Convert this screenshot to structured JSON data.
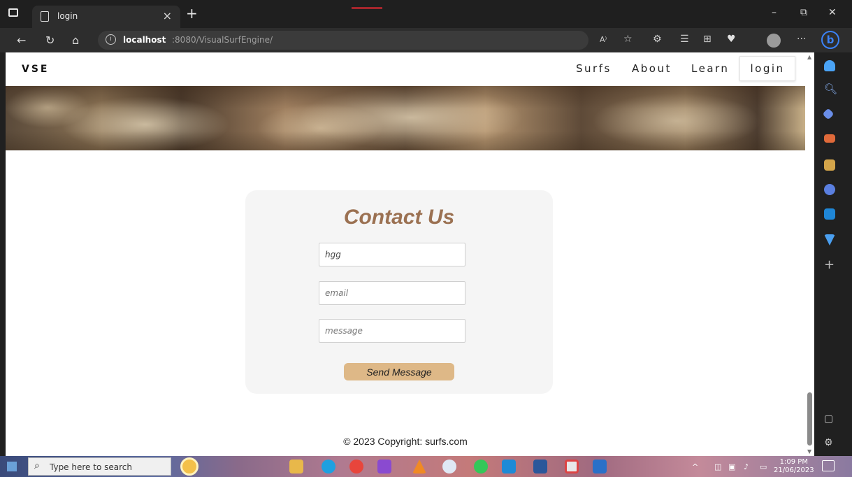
{
  "browser": {
    "tab_title": "login",
    "tab_close": "×",
    "new_tab": "+",
    "url_host": "localhost",
    "url_path": ":8080/VisualSurfEngine/",
    "read_aloud": "A⁾",
    "more": "···"
  },
  "site": {
    "brand": "VSE",
    "nav": {
      "surfs": "Surfs",
      "about": "About",
      "learn": "Learn",
      "login": "login"
    }
  },
  "contact": {
    "title": "Contact Us",
    "name_value": "hgg",
    "email_placeholder": "email",
    "message_placeholder": "message",
    "send_label": "Send Message"
  },
  "footer": {
    "copyright": "© 2023 Copyright: surfs.com"
  },
  "taskbar": {
    "search_placeholder": "Type here to search",
    "time": "1:09 PM",
    "date": "21/06/2023"
  },
  "colors": {
    "title_brown": "#9b7152",
    "button_tan": "#deb887",
    "card_bg": "#f5f5f5"
  }
}
